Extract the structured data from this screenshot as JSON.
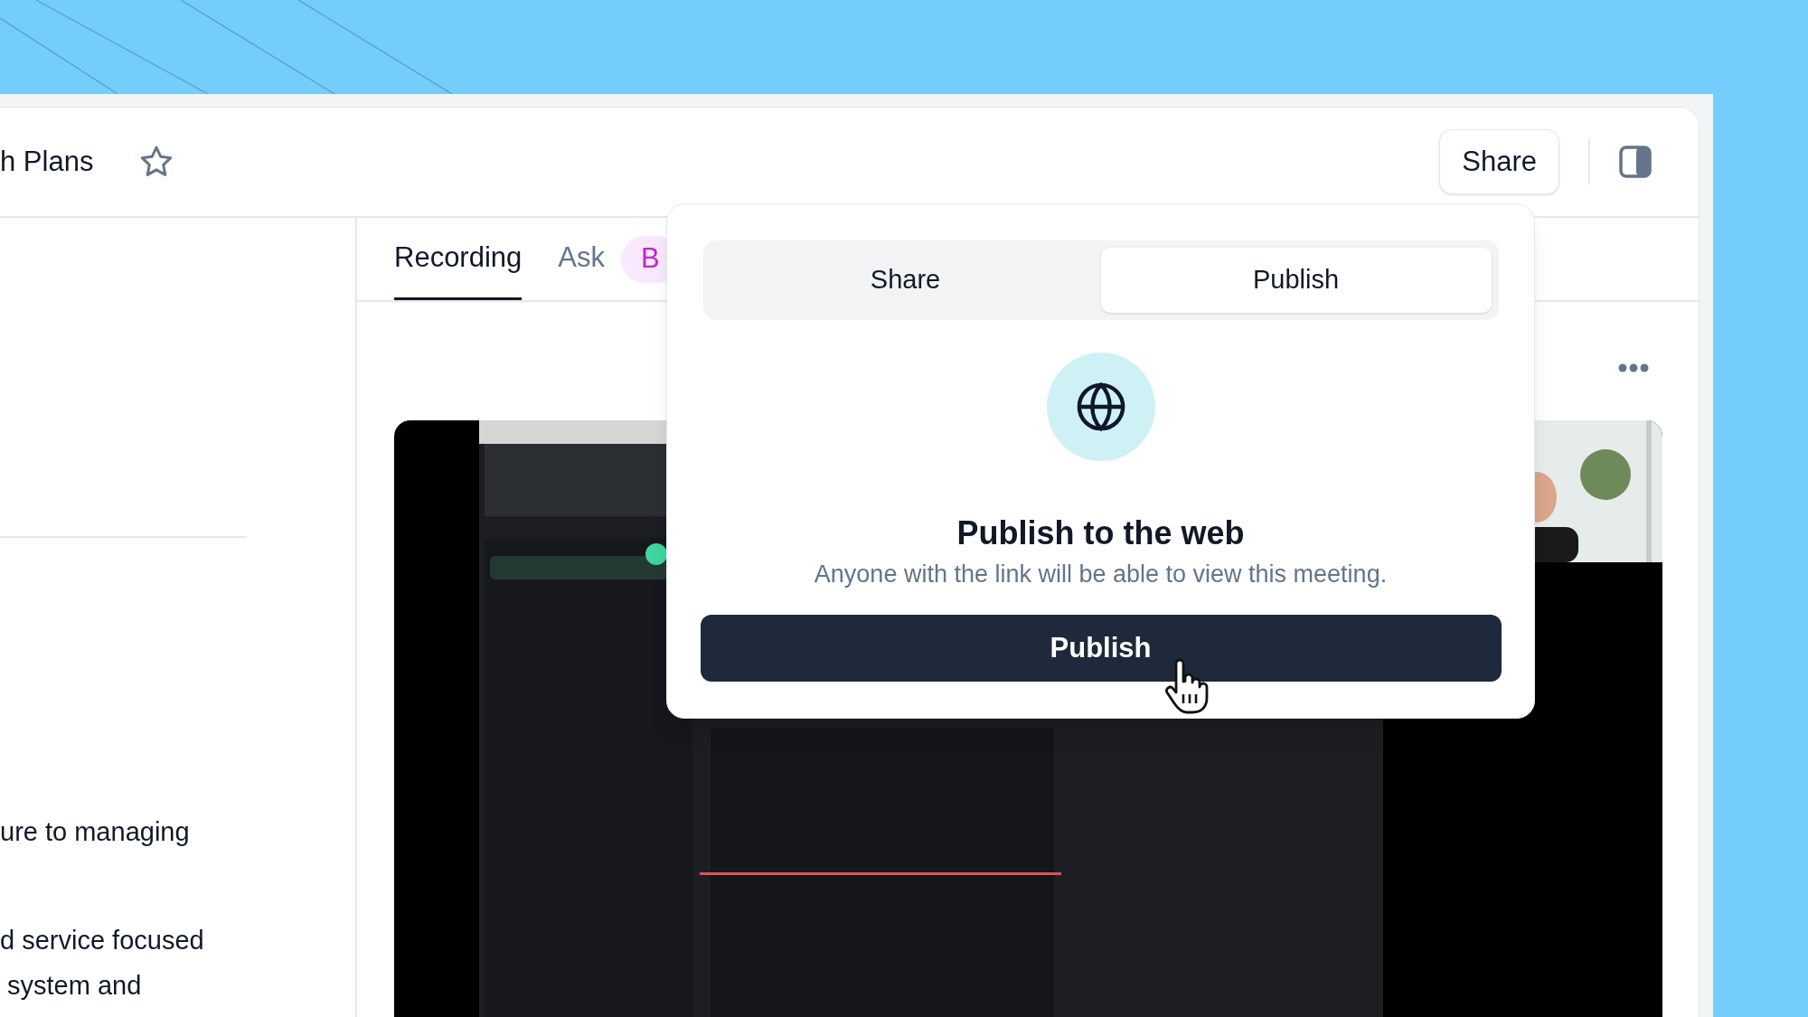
{
  "window": {
    "title": "h Plans",
    "starred": false,
    "share_button": "Share"
  },
  "tabs": [
    {
      "label": "Recording",
      "selected": true,
      "kind": "text"
    },
    {
      "label": "Ask",
      "selected": false,
      "kind": "text"
    },
    {
      "label": "B",
      "selected": false,
      "kind": "pill"
    }
  ],
  "notes": {
    "paragraphs": [
      [
        "ure to managing"
      ],
      [
        "d service focused",
        " system and"
      ]
    ]
  },
  "popover": {
    "segments": [
      {
        "label": "Share",
        "selected": false
      },
      {
        "label": "Publish",
        "selected": true
      }
    ],
    "title": "Publish to the web",
    "description": "Anyone with the link will be able to view this meeting.",
    "button": "Publish"
  }
}
